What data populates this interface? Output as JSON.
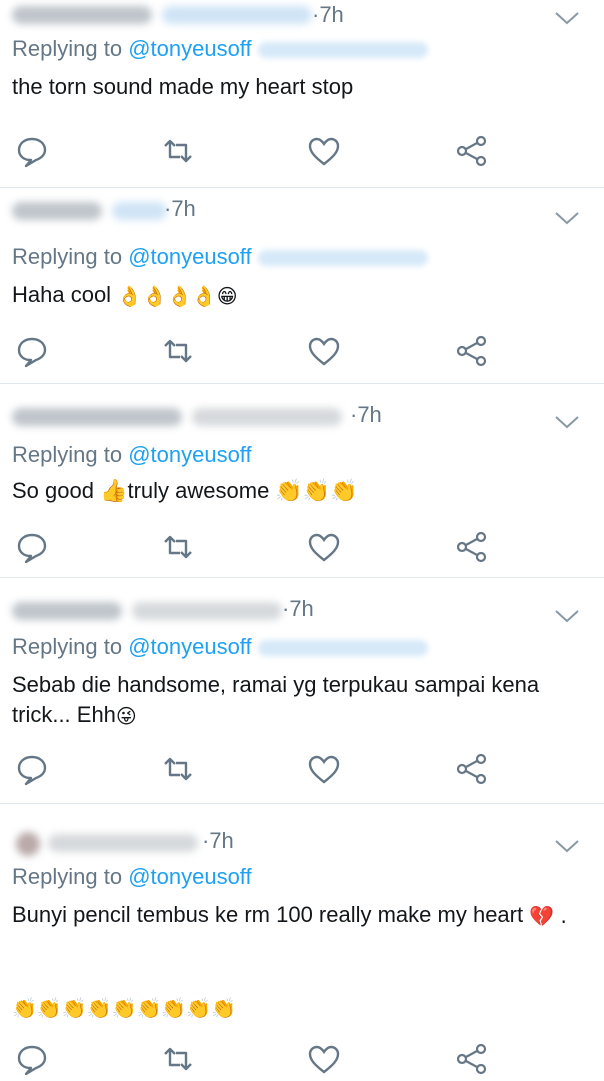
{
  "tweets": [
    {
      "time": "·7h",
      "reply_prefix": "Replying to ",
      "reply_handle": "@tonyeusoff",
      "text": "the torn sound made my heart stop",
      "emoji": ""
    },
    {
      "time": "·7h",
      "reply_prefix": "Replying to ",
      "reply_handle": "@tonyeusoff",
      "text": "Haha cool ",
      "emoji": "👌👌👌👌😁"
    },
    {
      "time": "·7h",
      "reply_prefix": "Replying to ",
      "reply_handle": "@tonyeusoff",
      "text": "So good ",
      "emoji": "👍truly awesome 👏👏👏"
    },
    {
      "time": "·7h",
      "reply_prefix": "Replying to ",
      "reply_handle": "@tonyeusoff",
      "text": "Sebab die handsome, ramai yg terpukau sampai kena trick... Ehh",
      "emoji": "😜"
    },
    {
      "time": "·7h",
      "reply_prefix": "Replying to ",
      "reply_handle": "@tonyeusoff",
      "text": "Bunyi pencil tembus ke rm 100 really make my heart",
      "emoji": "💔 .",
      "extra_emoji": "👏👏👏👏👏👏👏👏👏"
    }
  ],
  "colors": {
    "text": "#14171a",
    "muted": "#657786",
    "link": "#1da1f2",
    "divider": "#e1e8ed"
  },
  "icons": [
    "reply-icon",
    "retweet-icon",
    "like-icon",
    "share-icon",
    "chevron-down-icon"
  ]
}
